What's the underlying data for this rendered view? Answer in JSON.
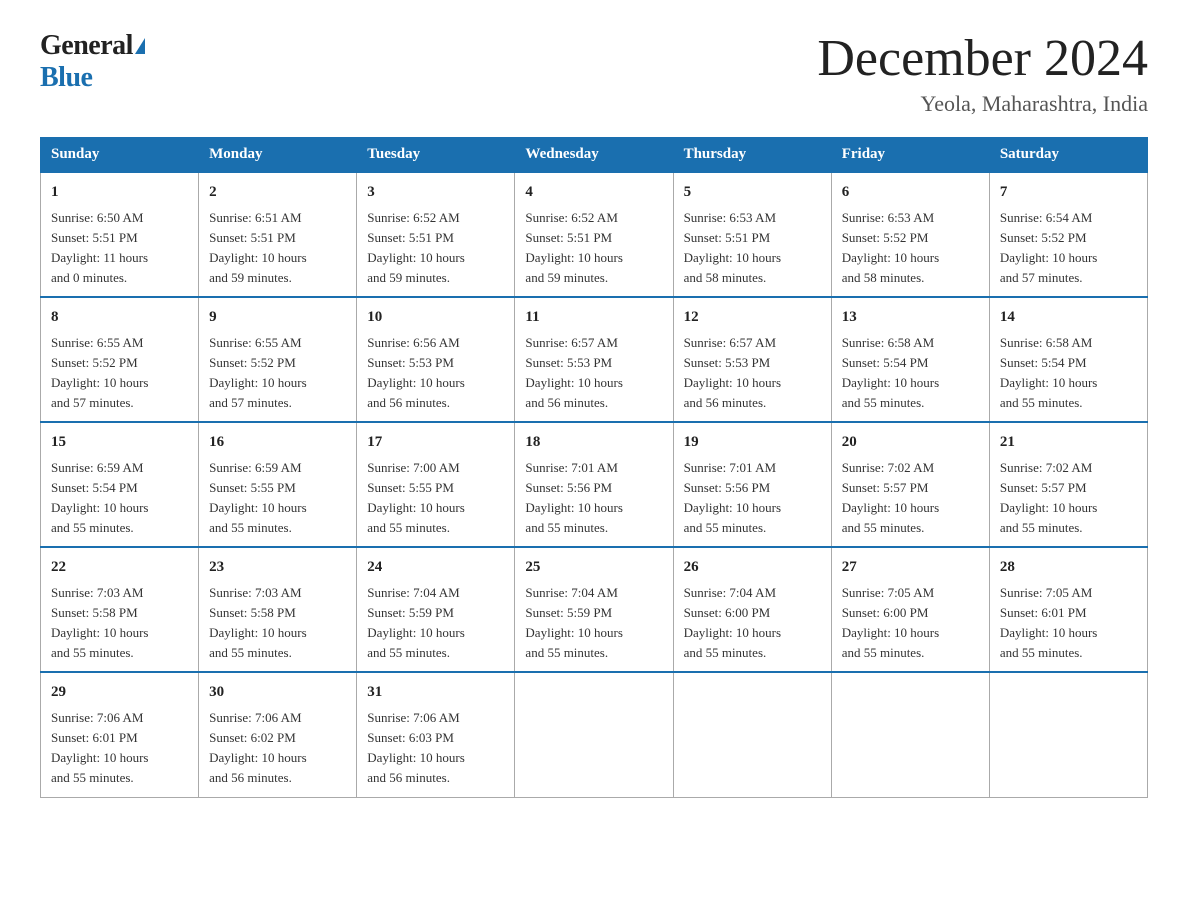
{
  "logo": {
    "general": "General",
    "blue": "Blue"
  },
  "title": "December 2024",
  "location": "Yeola, Maharashtra, India",
  "headers": [
    "Sunday",
    "Monday",
    "Tuesday",
    "Wednesday",
    "Thursday",
    "Friday",
    "Saturday"
  ],
  "weeks": [
    [
      {
        "day": "1",
        "sunrise": "6:50 AM",
        "sunset": "5:51 PM",
        "daylight": "11 hours and 0 minutes."
      },
      {
        "day": "2",
        "sunrise": "6:51 AM",
        "sunset": "5:51 PM",
        "daylight": "10 hours and 59 minutes."
      },
      {
        "day": "3",
        "sunrise": "6:52 AM",
        "sunset": "5:51 PM",
        "daylight": "10 hours and 59 minutes."
      },
      {
        "day": "4",
        "sunrise": "6:52 AM",
        "sunset": "5:51 PM",
        "daylight": "10 hours and 59 minutes."
      },
      {
        "day": "5",
        "sunrise": "6:53 AM",
        "sunset": "5:51 PM",
        "daylight": "10 hours and 58 minutes."
      },
      {
        "day": "6",
        "sunrise": "6:53 AM",
        "sunset": "5:52 PM",
        "daylight": "10 hours and 58 minutes."
      },
      {
        "day": "7",
        "sunrise": "6:54 AM",
        "sunset": "5:52 PM",
        "daylight": "10 hours and 57 minutes."
      }
    ],
    [
      {
        "day": "8",
        "sunrise": "6:55 AM",
        "sunset": "5:52 PM",
        "daylight": "10 hours and 57 minutes."
      },
      {
        "day": "9",
        "sunrise": "6:55 AM",
        "sunset": "5:52 PM",
        "daylight": "10 hours and 57 minutes."
      },
      {
        "day": "10",
        "sunrise": "6:56 AM",
        "sunset": "5:53 PM",
        "daylight": "10 hours and 56 minutes."
      },
      {
        "day": "11",
        "sunrise": "6:57 AM",
        "sunset": "5:53 PM",
        "daylight": "10 hours and 56 minutes."
      },
      {
        "day": "12",
        "sunrise": "6:57 AM",
        "sunset": "5:53 PM",
        "daylight": "10 hours and 56 minutes."
      },
      {
        "day": "13",
        "sunrise": "6:58 AM",
        "sunset": "5:54 PM",
        "daylight": "10 hours and 55 minutes."
      },
      {
        "day": "14",
        "sunrise": "6:58 AM",
        "sunset": "5:54 PM",
        "daylight": "10 hours and 55 minutes."
      }
    ],
    [
      {
        "day": "15",
        "sunrise": "6:59 AM",
        "sunset": "5:54 PM",
        "daylight": "10 hours and 55 minutes."
      },
      {
        "day": "16",
        "sunrise": "6:59 AM",
        "sunset": "5:55 PM",
        "daylight": "10 hours and 55 minutes."
      },
      {
        "day": "17",
        "sunrise": "7:00 AM",
        "sunset": "5:55 PM",
        "daylight": "10 hours and 55 minutes."
      },
      {
        "day": "18",
        "sunrise": "7:01 AM",
        "sunset": "5:56 PM",
        "daylight": "10 hours and 55 minutes."
      },
      {
        "day": "19",
        "sunrise": "7:01 AM",
        "sunset": "5:56 PM",
        "daylight": "10 hours and 55 minutes."
      },
      {
        "day": "20",
        "sunrise": "7:02 AM",
        "sunset": "5:57 PM",
        "daylight": "10 hours and 55 minutes."
      },
      {
        "day": "21",
        "sunrise": "7:02 AM",
        "sunset": "5:57 PM",
        "daylight": "10 hours and 55 minutes."
      }
    ],
    [
      {
        "day": "22",
        "sunrise": "7:03 AM",
        "sunset": "5:58 PM",
        "daylight": "10 hours and 55 minutes."
      },
      {
        "day": "23",
        "sunrise": "7:03 AM",
        "sunset": "5:58 PM",
        "daylight": "10 hours and 55 minutes."
      },
      {
        "day": "24",
        "sunrise": "7:04 AM",
        "sunset": "5:59 PM",
        "daylight": "10 hours and 55 minutes."
      },
      {
        "day": "25",
        "sunrise": "7:04 AM",
        "sunset": "5:59 PM",
        "daylight": "10 hours and 55 minutes."
      },
      {
        "day": "26",
        "sunrise": "7:04 AM",
        "sunset": "6:00 PM",
        "daylight": "10 hours and 55 minutes."
      },
      {
        "day": "27",
        "sunrise": "7:05 AM",
        "sunset": "6:00 PM",
        "daylight": "10 hours and 55 minutes."
      },
      {
        "day": "28",
        "sunrise": "7:05 AM",
        "sunset": "6:01 PM",
        "daylight": "10 hours and 55 minutes."
      }
    ],
    [
      {
        "day": "29",
        "sunrise": "7:06 AM",
        "sunset": "6:01 PM",
        "daylight": "10 hours and 55 minutes."
      },
      {
        "day": "30",
        "sunrise": "7:06 AM",
        "sunset": "6:02 PM",
        "daylight": "10 hours and 56 minutes."
      },
      {
        "day": "31",
        "sunrise": "7:06 AM",
        "sunset": "6:03 PM",
        "daylight": "10 hours and 56 minutes."
      },
      null,
      null,
      null,
      null
    ]
  ]
}
